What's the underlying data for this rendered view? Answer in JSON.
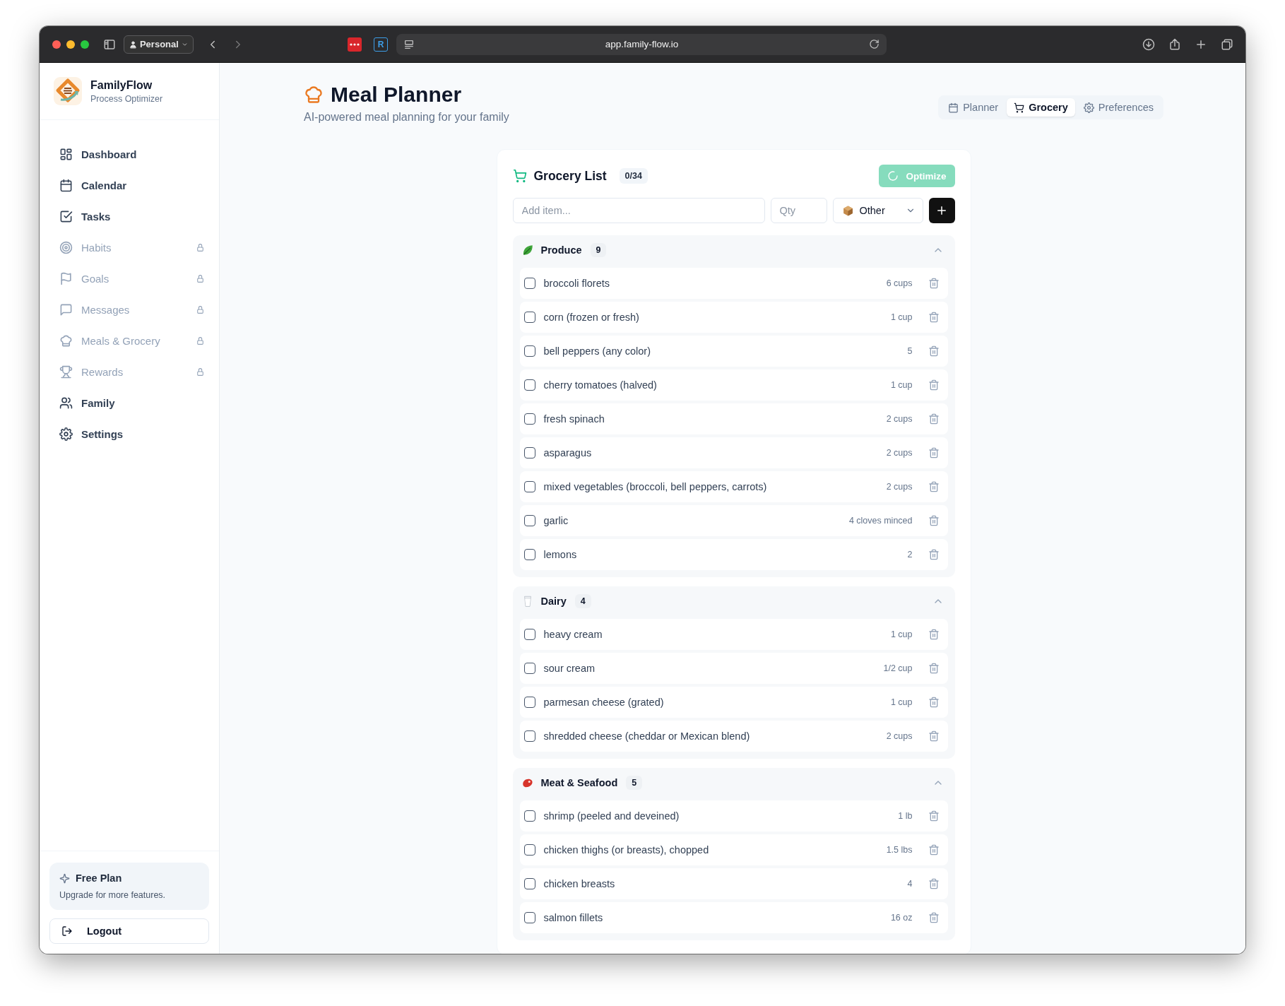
{
  "browser": {
    "profile": "Personal",
    "extension_label": "R",
    "url": "app.family-flow.io"
  },
  "sidebar": {
    "brand": {
      "name": "FamilyFlow",
      "tagline": "Process Optimizer"
    },
    "items": [
      {
        "label": "Dashboard",
        "locked": false
      },
      {
        "label": "Calendar",
        "locked": false
      },
      {
        "label": "Tasks",
        "locked": false
      },
      {
        "label": "Habits",
        "locked": true
      },
      {
        "label": "Goals",
        "locked": true
      },
      {
        "label": "Messages",
        "locked": true
      },
      {
        "label": "Meals & Grocery",
        "locked": true
      },
      {
        "label": "Rewards",
        "locked": true
      },
      {
        "label": "Family",
        "locked": false
      },
      {
        "label": "Settings",
        "locked": false
      }
    ],
    "plan": {
      "title": "Free Plan",
      "text": "Upgrade for more features."
    },
    "logout": "Logout"
  },
  "header": {
    "title": "Meal Planner",
    "subtitle": "AI-powered meal planning for your family",
    "tabs": [
      {
        "label": "Planner",
        "selected": false
      },
      {
        "label": "Grocery",
        "selected": true
      },
      {
        "label": "Preferences",
        "selected": false
      }
    ]
  },
  "grocery": {
    "title": "Grocery List",
    "count": "0/34",
    "optimize": {
      "label": "Optimize",
      "busy": true
    },
    "add": {
      "item_placeholder": "Add item...",
      "qty_placeholder": "Qty",
      "category": "Other"
    },
    "groups": [
      {
        "name": "Produce",
        "count": "9",
        "expanded": true,
        "items": [
          {
            "name": "broccoli florets",
            "qty": "6 cups",
            "checked": false
          },
          {
            "name": "corn (frozen or fresh)",
            "qty": "1 cup",
            "checked": false
          },
          {
            "name": "bell peppers (any color)",
            "qty": "5",
            "checked": false
          },
          {
            "name": "cherry tomatoes (halved)",
            "qty": "1 cup",
            "checked": false
          },
          {
            "name": "fresh spinach",
            "qty": "2 cups",
            "checked": false
          },
          {
            "name": "asparagus",
            "qty": "2 cups",
            "checked": false
          },
          {
            "name": "mixed vegetables (broccoli, bell peppers, carrots)",
            "qty": "2 cups",
            "checked": false
          },
          {
            "name": "garlic",
            "qty": "4 cloves minced",
            "checked": false
          },
          {
            "name": "lemons",
            "qty": "2",
            "checked": false
          }
        ]
      },
      {
        "name": "Dairy",
        "count": "4",
        "expanded": true,
        "items": [
          {
            "name": "heavy cream",
            "qty": "1 cup",
            "checked": false
          },
          {
            "name": "sour cream",
            "qty": "1/2 cup",
            "checked": false
          },
          {
            "name": "parmesan cheese (grated)",
            "qty": "1 cup",
            "checked": false
          },
          {
            "name": "shredded cheese (cheddar or Mexican blend)",
            "qty": "2 cups",
            "checked": false
          }
        ]
      },
      {
        "name": "Meat & Seafood",
        "count": "5",
        "expanded": true,
        "items": [
          {
            "name": "shrimp (peeled and deveined)",
            "qty": "1 lb",
            "checked": false
          },
          {
            "name": "chicken thighs (or breasts), chopped",
            "qty": "1.5 lbs",
            "checked": false
          },
          {
            "name": "chicken breasts",
            "qty": "4",
            "checked": false
          },
          {
            "name": "salmon fillets",
            "qty": "16 oz",
            "checked": false
          }
        ]
      }
    ]
  }
}
